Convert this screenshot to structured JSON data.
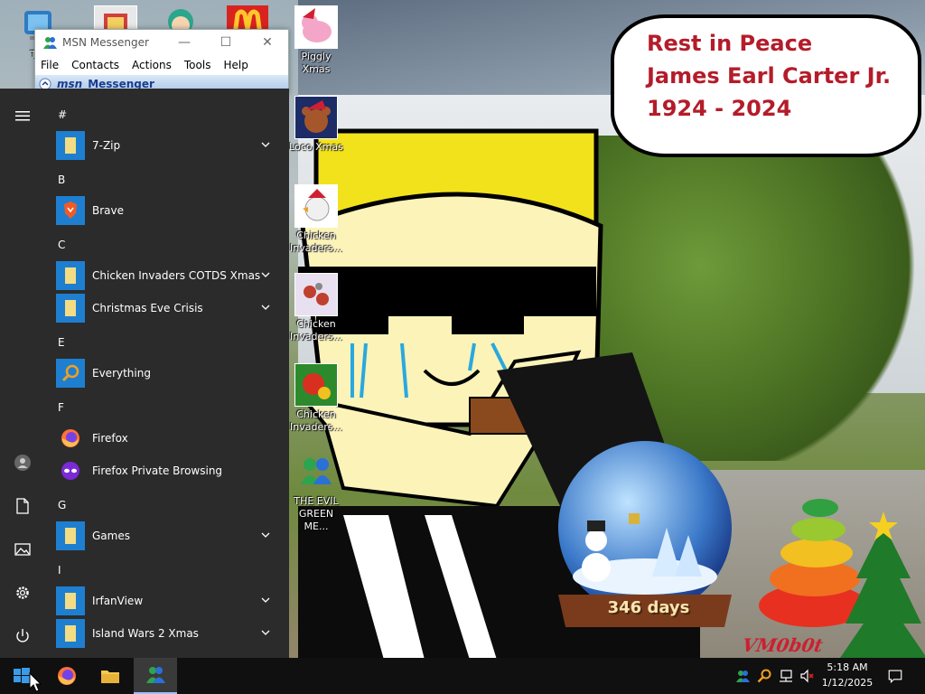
{
  "desktop": {
    "icons": [
      {
        "label": "Thi",
        "icon": "this-pc-icon"
      },
      {
        "label": "Piggly Xmas",
        "icon": "pig-icon"
      },
      {
        "label": "Loco Xmas",
        "icon": "bear-icon"
      },
      {
        "label": "Chicken Invaders...",
        "icon": "chicken-icon"
      },
      {
        "label": "Chicken Invaders...",
        "icon": "chicken-space-icon"
      },
      {
        "label": "Chicken Invaders...",
        "icon": "chicken-red-icon"
      },
      {
        "label": "THE EVIL GREEN ME...",
        "icon": "msn-people-icon"
      }
    ],
    "speech_bubble": {
      "line1": "Rest in Peace",
      "line2": "James Earl Carter Jr.",
      "line3": "1924 - 2024"
    },
    "snow_globe_counter": "346 days",
    "signature": "VM0b0t"
  },
  "msn_window": {
    "title": "MSN Messenger",
    "menu": [
      "File",
      "Contacts",
      "Actions",
      "Tools",
      "Help"
    ],
    "brand_logo": "msn",
    "brand_sub": "Messenger",
    "minimize_glyph": "—",
    "maximize_glyph": "☐",
    "close_glyph": "✕"
  },
  "start_menu": {
    "sections": [
      {
        "letter": "#",
        "apps": [
          {
            "name": "7-Zip",
            "icon": "folder-icon",
            "expandable": true
          }
        ]
      },
      {
        "letter": "B",
        "apps": [
          {
            "name": "Brave",
            "icon": "brave-icon",
            "expandable": false
          }
        ]
      },
      {
        "letter": "C",
        "apps": [
          {
            "name": "Chicken Invaders COTDS Xmas",
            "icon": "folder-icon",
            "expandable": true
          },
          {
            "name": "Christmas Eve Crisis",
            "icon": "folder-icon",
            "expandable": true
          }
        ]
      },
      {
        "letter": "E",
        "apps": [
          {
            "name": "Everything",
            "icon": "everything-search-icon",
            "expandable": false
          }
        ]
      },
      {
        "letter": "F",
        "apps": [
          {
            "name": "Firefox",
            "icon": "firefox-icon",
            "expandable": false
          },
          {
            "name": "Firefox Private Browsing",
            "icon": "firefox-private-icon",
            "expandable": false
          }
        ]
      },
      {
        "letter": "G",
        "apps": [
          {
            "name": "Games",
            "icon": "folder-icon",
            "expandable": true
          }
        ]
      },
      {
        "letter": "I",
        "apps": [
          {
            "name": "IrfanView",
            "icon": "folder-icon",
            "expandable": true
          },
          {
            "name": "Island Wars 2 Xmas",
            "icon": "folder-icon",
            "expandable": true
          }
        ]
      }
    ],
    "rail": [
      "hamburger-icon",
      "user-icon",
      "documents-icon",
      "pictures-icon",
      "settings-icon",
      "power-icon"
    ]
  },
  "taskbar": {
    "pinned": [
      "start-icon",
      "firefox-icon",
      "file-explorer-icon",
      "msn-messenger-icon"
    ],
    "tray": [
      "msn-tray-icon",
      "search-tray-icon",
      "network-icon",
      "volume-muted-icon"
    ],
    "time": "5:18 AM",
    "date": "1/12/2025"
  },
  "colors": {
    "start_bg": "#2b2b2b",
    "tile_blue": "#1e7fd1",
    "bubble_text": "#b41c2a",
    "taskbar_bg": "#101010"
  }
}
